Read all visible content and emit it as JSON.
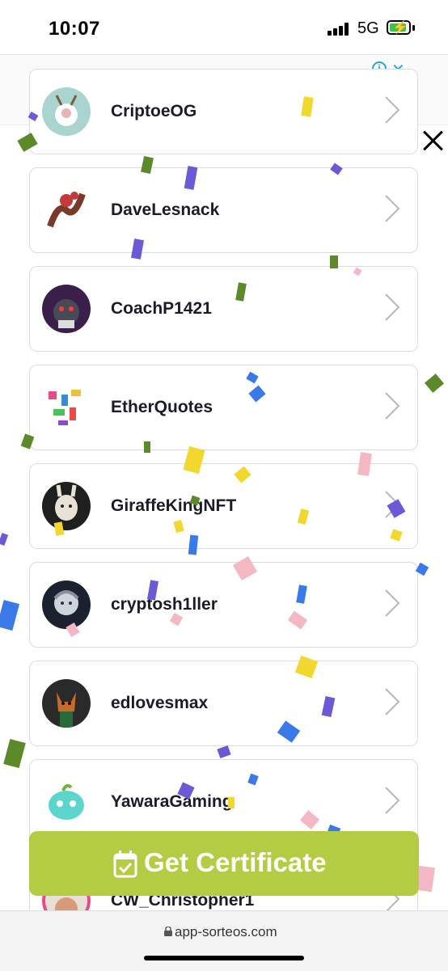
{
  "status_bar": {
    "time": "10:07",
    "network": "5G"
  },
  "ad": {
    "info_icon": "info-icon",
    "close_icon": "close-icon"
  },
  "overlay_close_icon": "close-icon",
  "entries": [
    {
      "username": "CriptoeOG"
    },
    {
      "username": "DaveLesnack"
    },
    {
      "username": "CoachP1421"
    },
    {
      "username": "EtherQuotes"
    },
    {
      "username": "GiraffeKingNFT"
    },
    {
      "username": "cryptosh1ller"
    },
    {
      "username": "edlovesmax"
    },
    {
      "username": "YawaraGaming"
    },
    {
      "username": "CW_Christopher1"
    }
  ],
  "certificate_button": {
    "label": "Get Certificate",
    "icon": "calendar-check-icon"
  },
  "browser": {
    "url": "app-sorteos.com",
    "icon": "lock-icon"
  },
  "colors": {
    "accent": "#b4cc44",
    "card_border": "#dcdce0"
  }
}
